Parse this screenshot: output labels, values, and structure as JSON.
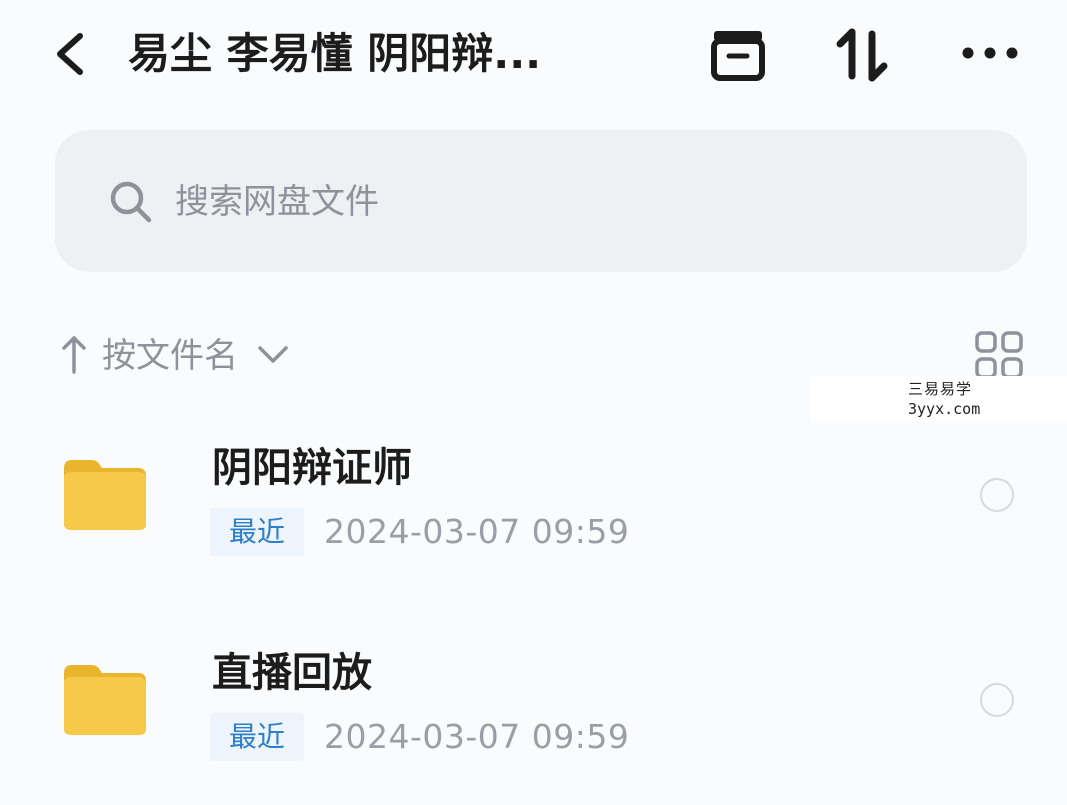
{
  "header": {
    "title": "易尘 李易懂 阴阳辩...",
    "icons": [
      "back-icon",
      "box-icon",
      "sort-icon",
      "more-icon"
    ]
  },
  "search": {
    "placeholder": "搜索网盘文件"
  },
  "sortbar": {
    "label": "按文件名"
  },
  "watermark": {
    "line1": "三易易学",
    "line2": "3yyx.com"
  },
  "files": [
    {
      "name": "阴阳辩证师",
      "badge": "最近",
      "time": "2024-03-07  09:59"
    },
    {
      "name": "直播回放",
      "badge": "最近",
      "time": "2024-03-07  09:59"
    }
  ],
  "colors": {
    "background": "#fafbfc",
    "search_bg": "#eef0f4",
    "folder": "#f7c948",
    "badge_bg": "#edf4fb",
    "badge_text": "#2e7fc9",
    "muted_text": "#8e929b"
  }
}
